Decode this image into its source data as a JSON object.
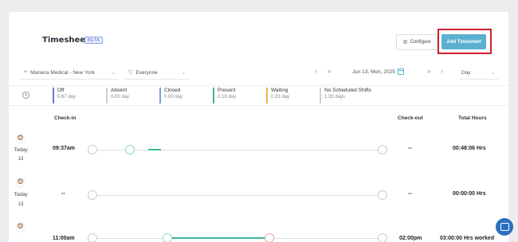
{
  "header": {
    "title": "Timesheets",
    "badge": "BETA",
    "configure_label": "Configure",
    "add_label": "Add Timesheet"
  },
  "filters": {
    "location": "Maniera Medical - New York",
    "employees": "Everyone",
    "date": "Jun 13, Mon, 2025",
    "view": "Day"
  },
  "summary": [
    {
      "label": "Off",
      "value": "0.67 day",
      "color": "#6b7bd6"
    },
    {
      "label": "Absent",
      "value": "0.00 day",
      "color": "#cfcfcf"
    },
    {
      "label": "Closed",
      "value": "0.00 day",
      "color": "#7a9fe0"
    },
    {
      "label": "Present",
      "value": "0.19 day",
      "color": "#3fb59a"
    },
    {
      "label": "Waiting",
      "value": "0.33 day",
      "color": "#e8b64a"
    },
    {
      "label": "No Scheduled Shifts",
      "value": "1.33 days",
      "color": "#cfcfcf"
    }
  ],
  "columns": {
    "checkin": "Check-in",
    "checkout": "Check-out",
    "total": "Total Hours"
  },
  "rows": [
    {
      "day": "Today",
      "date": "13",
      "checkin": "09:37am",
      "checkout": "--",
      "total": "00:48:06 Hrs"
    },
    {
      "day": "Today",
      "date": "13",
      "checkin": "--",
      "checkout": "--",
      "total": "00:00:00 Hrs"
    },
    {
      "day": "",
      "date": "",
      "checkin": "11:00am",
      "checkout": "02:00pm",
      "total": "03:00:00 Hrs worked"
    }
  ],
  "colors": {
    "accent": "#5bb0d0",
    "highlight": "#d0202e",
    "present": "#3fb59a"
  }
}
